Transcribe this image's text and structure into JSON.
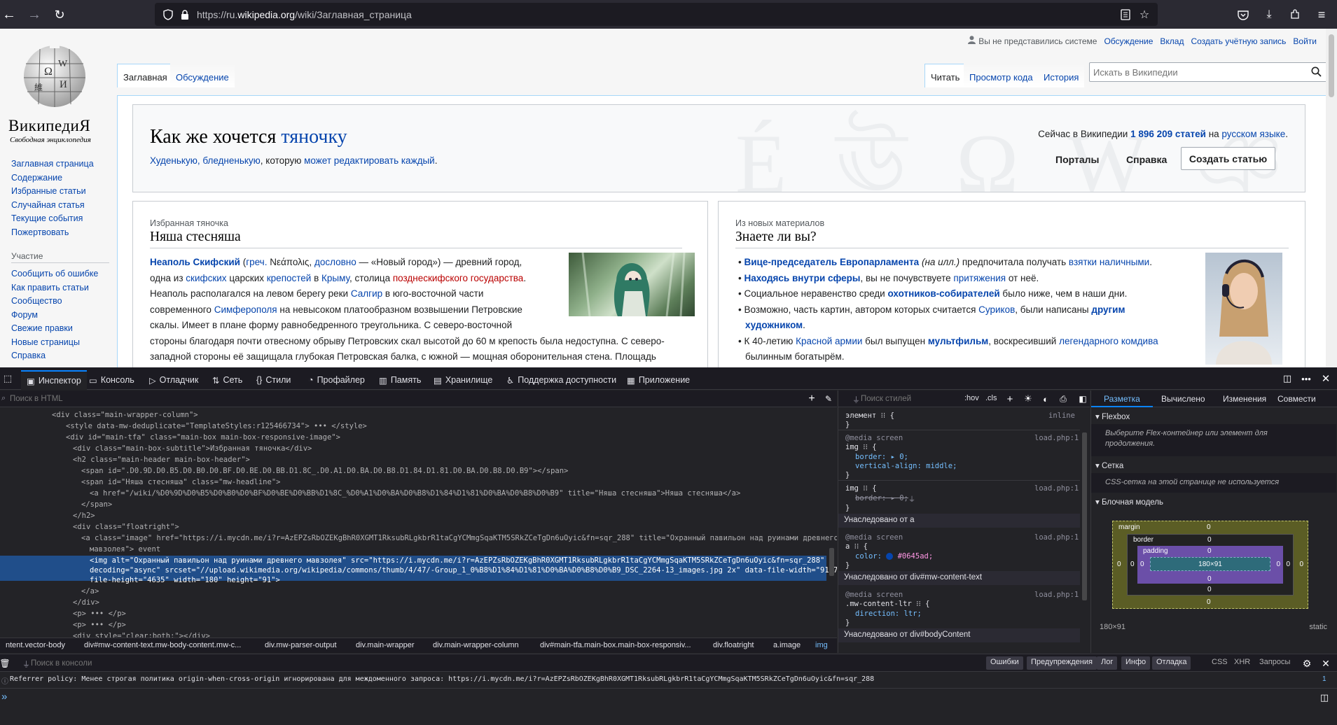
{
  "browser": {
    "url_prefix": "https://ru.",
    "url_domain": "wikipedia.org",
    "url_path": "/wiki/Заглавная_страница"
  },
  "personal": {
    "not_logged": "Вы не представились системе",
    "discussion": "Обсуждение",
    "contributions": "Вклад",
    "create_account": "Создать учётную запись",
    "login": "Войти"
  },
  "logo": {
    "title": "ВикипедиЯ",
    "tagline": "Свободная энциклопедия"
  },
  "sidebar": {
    "main": [
      "Заглавная страница",
      "Содержание",
      "Избранные статьи",
      "Случайная статья",
      "Текущие события",
      "Пожертвовать"
    ],
    "participation_heading": "Участие",
    "participation": [
      "Сообщить об ошибке",
      "Как править статьи",
      "Сообщество",
      "Форум",
      "Свежие правки",
      "Новые страницы",
      "Справка"
    ]
  },
  "tabs": {
    "article": "Заглавная",
    "talk": "Обсуждение",
    "read": "Читать",
    "view_source": "Просмотр кода",
    "history": "История"
  },
  "search": {
    "placeholder": "Искать в Википедии"
  },
  "banner": {
    "title_a": "Как же хочется ",
    "title_b": "тяночку",
    "sub_a": "Худенькую, бледненькую",
    "sub_b": ", которую ",
    "sub_c": "может редактировать каждый",
    "sub_d": ".",
    "stats_a": "Сейчас в Википедии ",
    "stats_b": "1 896 209 статей",
    "stats_c": " на ",
    "stats_d": "русском языке",
    "stats_e": ".",
    "portals": "Порталы",
    "help": "Справка",
    "create": "Создать статью"
  },
  "tfa": {
    "subtitle": "Избранная тяночка",
    "title": "Няша стесняша",
    "p1": [
      "Неаполь Скифский",
      " (",
      "греч.",
      " Νεάπολις, ",
      "дословно",
      " — «Новый город») — древний город,"
    ],
    "p2": [
      "одна из ",
      "скифских",
      " царских ",
      "крепостей",
      " в ",
      "Крыму",
      ", столица ",
      "позднескифского государства",
      "."
    ],
    "p3": [
      "Неаполь располагался на левом берегу реки ",
      "Салгир",
      " в юго-восточной части"
    ],
    "p4": [
      "современного ",
      "Симферополя",
      " на невысоком платообразном возвышении Петровские"
    ],
    "p5": "скалы. Имеет в плане форму равнобедренного треугольника. С северо-восточной",
    "p6": "стороны благодаря почти отвесному обрыву Петровских скал высотой до 60 м крепость была недоступна. С северо-",
    "p7": "западной стороны её защищала глубокая Петровская балка, с южной — мощная оборонительная стена. Площадь"
  },
  "dyk": {
    "subtitle": "Из новых материалов",
    "title": "Знаете ли вы?",
    "i1": [
      "Вице-председатель Европарламента",
      " (на илл.)",
      " предпочитала получать ",
      "взятки наличными",
      "."
    ],
    "i2": [
      "Находясь внутри сферы",
      ", вы не почувствуете ",
      "притяжения",
      " от неё."
    ],
    "i3": [
      "Социальное неравенство среди ",
      "охотников-собирателей",
      " было ниже, чем в наши дни."
    ],
    "i4": [
      "Возможно, часть картин, автором которых считается ",
      "Суриков",
      ", были написаны ",
      "другим"
    ],
    "i4b": "художником",
    "i4c": ".",
    "i5": [
      "К 40-летию ",
      "Красной армии",
      " был выпущен ",
      "мультфильм",
      ", воскресивший ",
      "легендарного комдива"
    ],
    "i5b": "былинным богатырём."
  },
  "devtools": {
    "tabs": [
      "Инспектор",
      "Консоль",
      "Отладчик",
      "Сеть",
      "Стили",
      "Профайлер",
      "Память",
      "Хранилище",
      "Поддержка доступности",
      "Приложение"
    ],
    "html_search": "Поиск в HTML",
    "styles_filter": "Поиск стилей",
    "hov": ":hov",
    "cls": ".cls",
    "layout_tabs": [
      "Разметка",
      "Вычислено",
      "Изменения",
      "Совмести"
    ],
    "flexbox_h": "Flexbox",
    "flexbox_msg": "Выберите Flex-контейнер или элемент для продолжения.",
    "grid_h": "Сетка",
    "grid_msg": "CSS-сетка на этой странице не используется",
    "box_h": "Блочная модель",
    "bm": {
      "margin": "margin",
      "border": "border",
      "padding": "padding",
      "size": "180×91",
      "zero": "0",
      "dims": "180×91",
      "position": "static"
    },
    "html_lines": [
      "<div class=\"main-wrapper-column\">",
      "<style data-mw-deduplicate=\"TemplateStyles:r125466734\"> ••• </style>",
      "<div id=\"main-tfa\" class=\"main-box main-box-responsive-image\">",
      "<div class=\"main-box-subtitle\">Избранная тяночка</div>",
      "<h2 class=\"main-header main-box-header\">",
      "<span id=\".D0.9D.D0.B5.D0.B0.D0.BF.D0.BE.D0.BB.D1.8C_.D0.A1.D0.BA.D0.B8.D1.84.D1.81.D0.BA.D0.B8.D0.B9\"></span>",
      "<span id=\"Няша стесняша\" class=\"mw-headline\">",
      "<a href=\"/wiki/%D0%9D%D0%B5%D0%B0%D0%BF%D0%BE%D0%BB%D1%8C_%D0%A1%D0%BA%D0%B8%D1%84%D1%81%D0%BA%D0%B8%D0%B9\" title=\"Няша стесняша\">Няша стесняша</a>",
      "</span>",
      "</h2>",
      "<div class=\"floatright\">",
      "<a class=\"image\" href=\"https://i.mycdn.me/i?r=AzEPZsRbOZEKgBhR0XGMT1RksubRLgkbrR1taCgYCMmgSqaKTM5SRkZCeTgDn6uOyic&fn=sqr_288\" title=\"Охранный павильон над руинами древнего",
      "мавзолея\"> event",
      "<img alt=\"Охранный павильон над руинами древнего мавзолея\" src=\"https://i.mycdn.me/i?r=AzEPZsRbOZEKgBhR0XGMT1RksubRLgkbrR1taCgYCMmgSqaKTM5SRkZCeTgDn6uOyic&fn=sqr_288\"",
      "decoding=\"async\" srcset=\"//upload.wikimedia.org/wikipedia/commons/thumb/4/47/-Group_1_0%B8%D1%84%D1%81%D0%BA%D0%B8%D0%B9_DSC_2264-13_images.jpg 2x\" data-file-width=\"9187\" data-",
      "file-height=\"4635\" width=\"180\" height=\"91\">",
      "</a>",
      "</div>",
      "<p> ••• </p>",
      "<p> ••• </p>",
      "<div style=\"clear:both;\"></div>"
    ],
    "breadcrumbs": [
      "ntent.vector-body",
      "div#mw-content-text.mw-body-content.mw-c...",
      "div.mw-parser-output",
      "div.main-wrapper",
      "div.main-wrapper-column",
      "div#main-tfa.main-box.main-box-responsiv...",
      "div.floatright",
      "a.image",
      "img"
    ],
    "rules": {
      "element": "элемент",
      "inline": "inline",
      "media": "@media screen",
      "src": "load.php:1",
      "img_sel": "img",
      "border0": "border: ▸ 0;",
      "valign": "vertical-align: middle;",
      "border_strike": "border: ▸ 0;",
      "inh_a": "Унаследовано от a",
      "a_sel": "a",
      "color": "color:",
      "color_val": "#0645ad;",
      "inh_content": "Унаследовано от div#mw-content-text",
      "ltr_sel": ".mw-content-ltr",
      "direction": "direction: ltr;",
      "inh_body": "Унаследовано от div#bodyContent"
    },
    "console_filter": "Поиск в консоли",
    "console_levels": [
      "Ошибки",
      "Предупреждения",
      "Лог",
      "Инфо",
      "Отладка"
    ],
    "console_extra": [
      "CSS",
      "XHR",
      "Запросы"
    ],
    "console_msg": "Referrer policy: Менее строгая политика origin-when-cross-origin игнорирована для междоменного запроса: https://i.mycdn.me/i?r=AzEPZsRbOZEKgBhR0XGMT1RksubRLgkbrR1taCgYCMmgSqaKTM5SRkZCeTgDn6uOyic&fn=sqr_288",
    "prompt": "»"
  }
}
